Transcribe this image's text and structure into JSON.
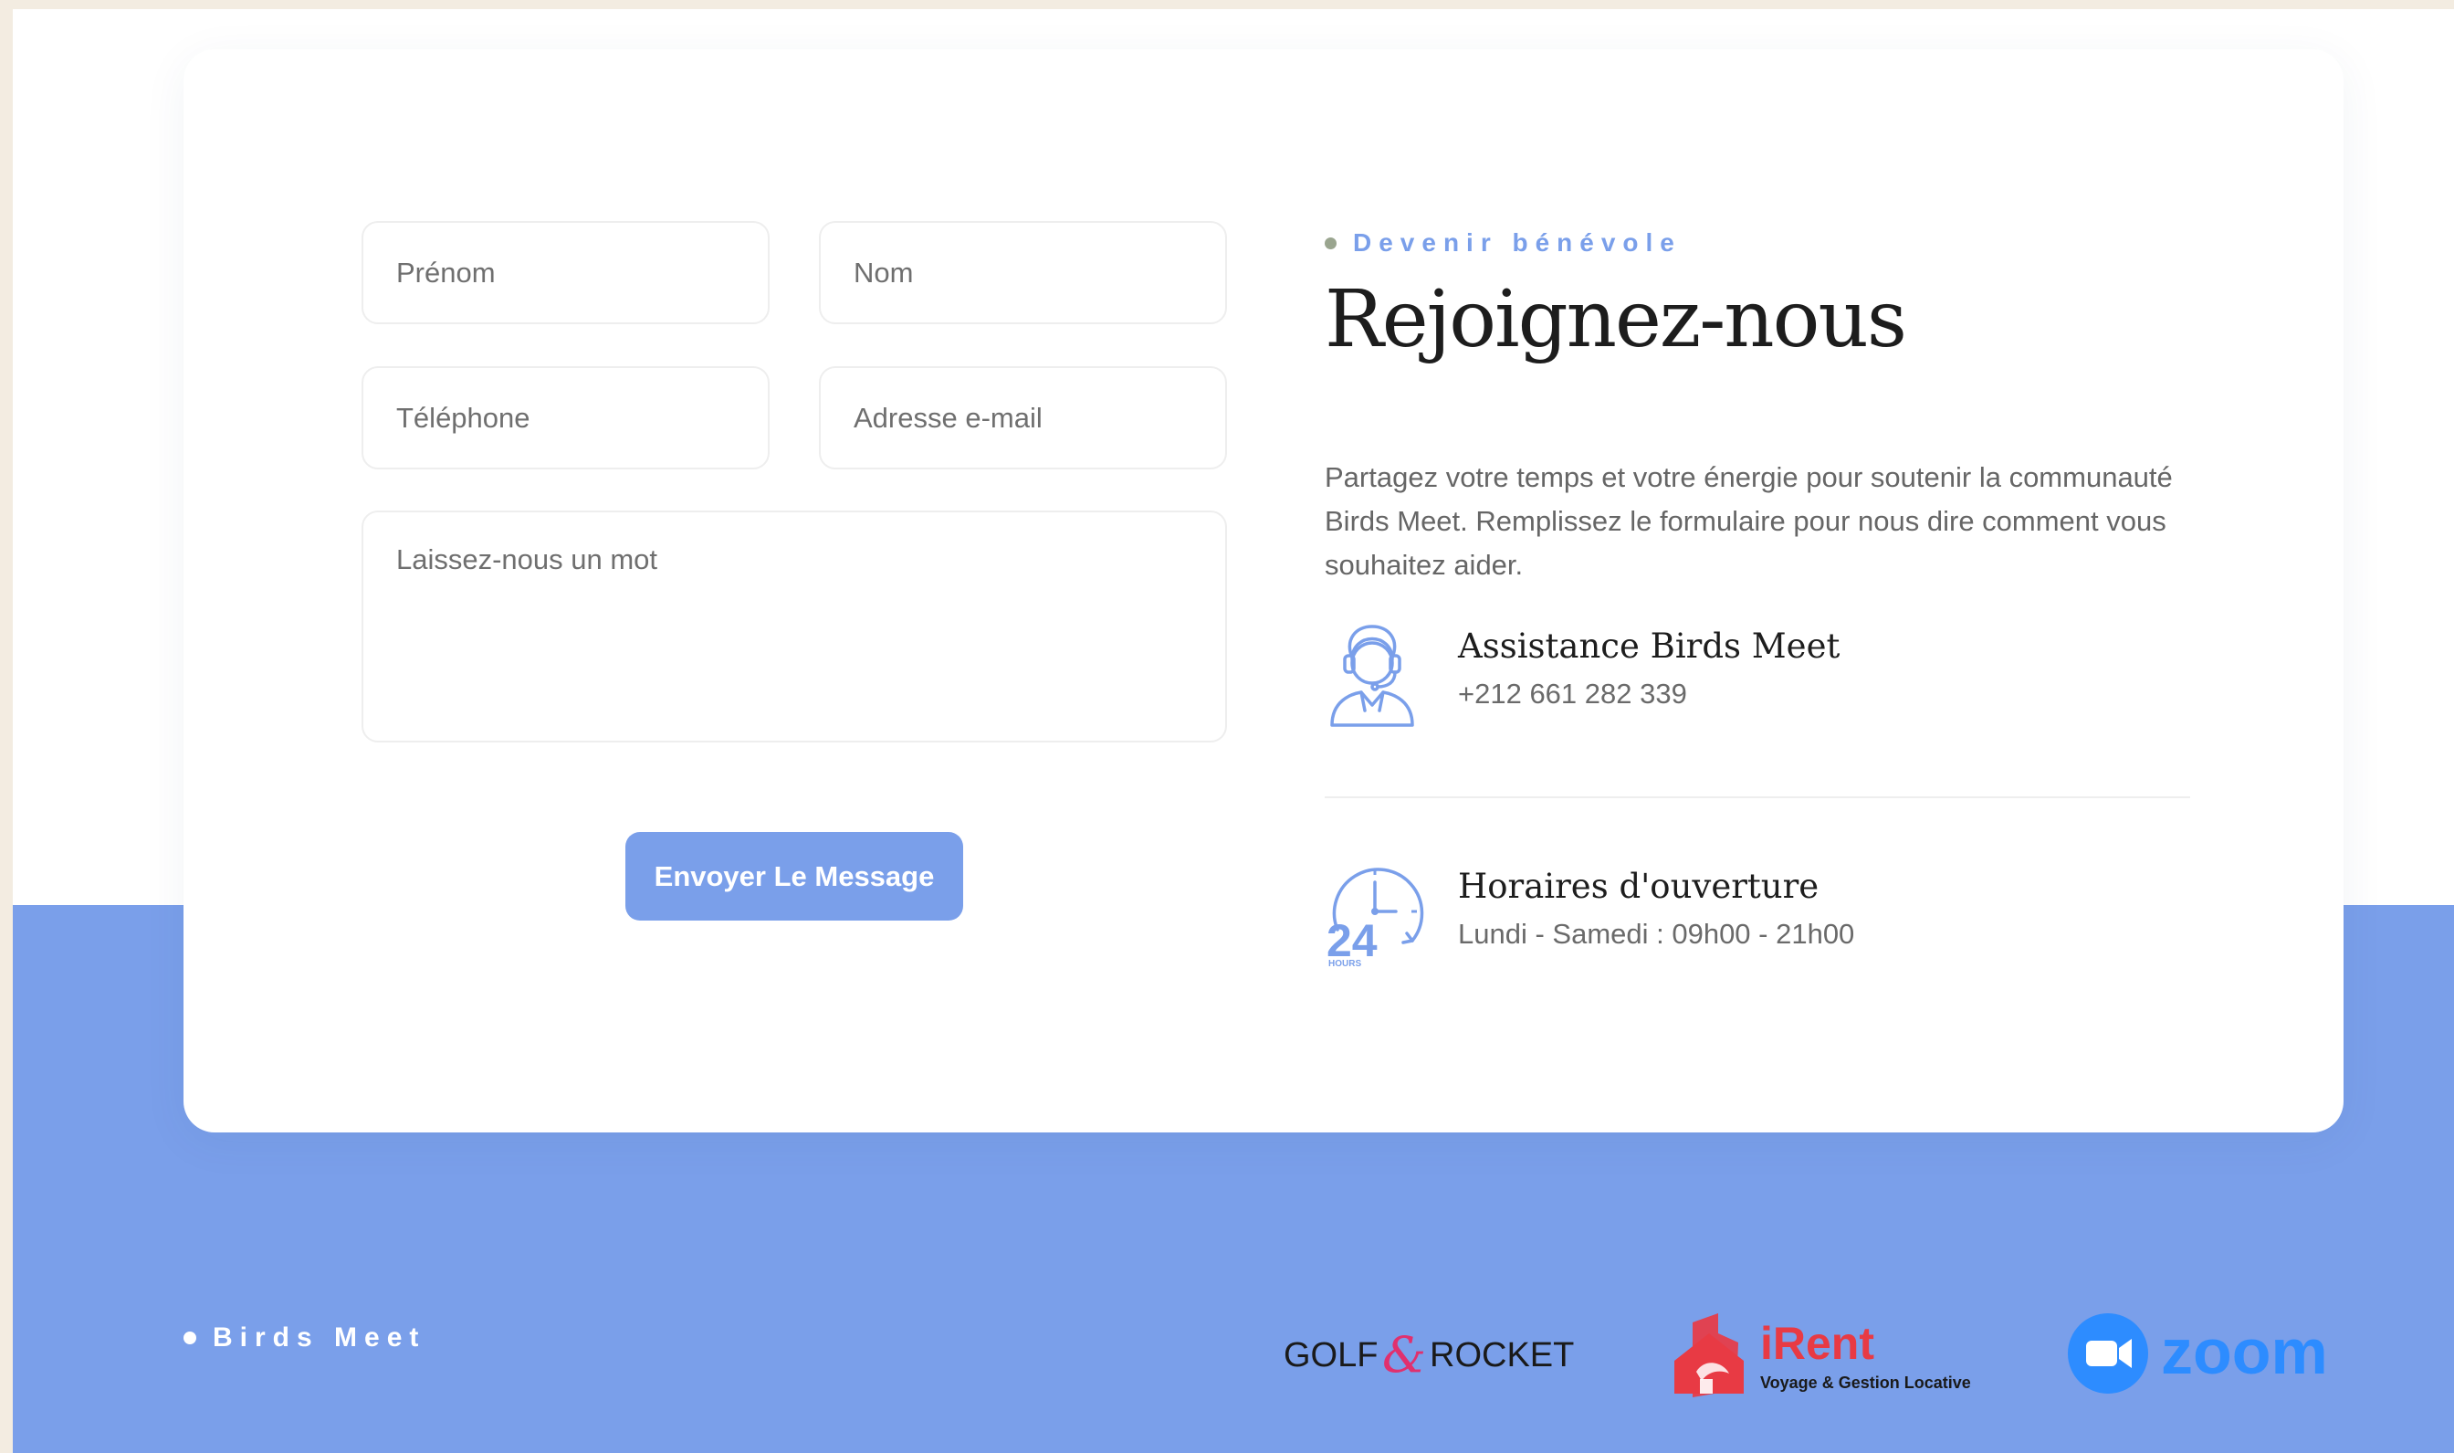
{
  "form": {
    "first_name_placeholder": "Prénom",
    "last_name_placeholder": "Nom",
    "phone_placeholder": "Téléphone",
    "email_placeholder": "Adresse e-mail",
    "message_placeholder": "Laissez-nous un mot",
    "submit_label": "Envoyer Le Message"
  },
  "intro": {
    "eyebrow": "Devenir bénévole",
    "title": "Rejoignez-nous",
    "description": "Partagez votre temps et votre énergie pour soutenir la communauté Birds Meet. Remplissez le formulaire pour nous dire comment vous souhaitez aider."
  },
  "contact": {
    "support_title": "Assistance Birds Meet",
    "support_phone": "+212 661 282 339",
    "hours_title": "Horaires d'ouverture",
    "hours_value": "Lundi - Samedi : 09h00 - 21h00",
    "hours_icon_number": "24",
    "hours_icon_caption": "HOURS"
  },
  "footer": {
    "brand": "Birds Meet",
    "partners": {
      "golf_left": "GOLF",
      "golf_amp": "&",
      "golf_right": "ROCKET",
      "irent_name": "iRent",
      "irent_tagline": "Voyage & Gestion Locative",
      "zoom_name": "zoom"
    }
  },
  "colors": {
    "accent": "#7a9fea",
    "background": "#f3ece1",
    "irent_red": "#e83a44",
    "zoom_blue": "#2d8cff",
    "golf_pink": "#e0306e"
  },
  "icons": [
    "support-agent-icon",
    "24-hours-clock-icon"
  ]
}
